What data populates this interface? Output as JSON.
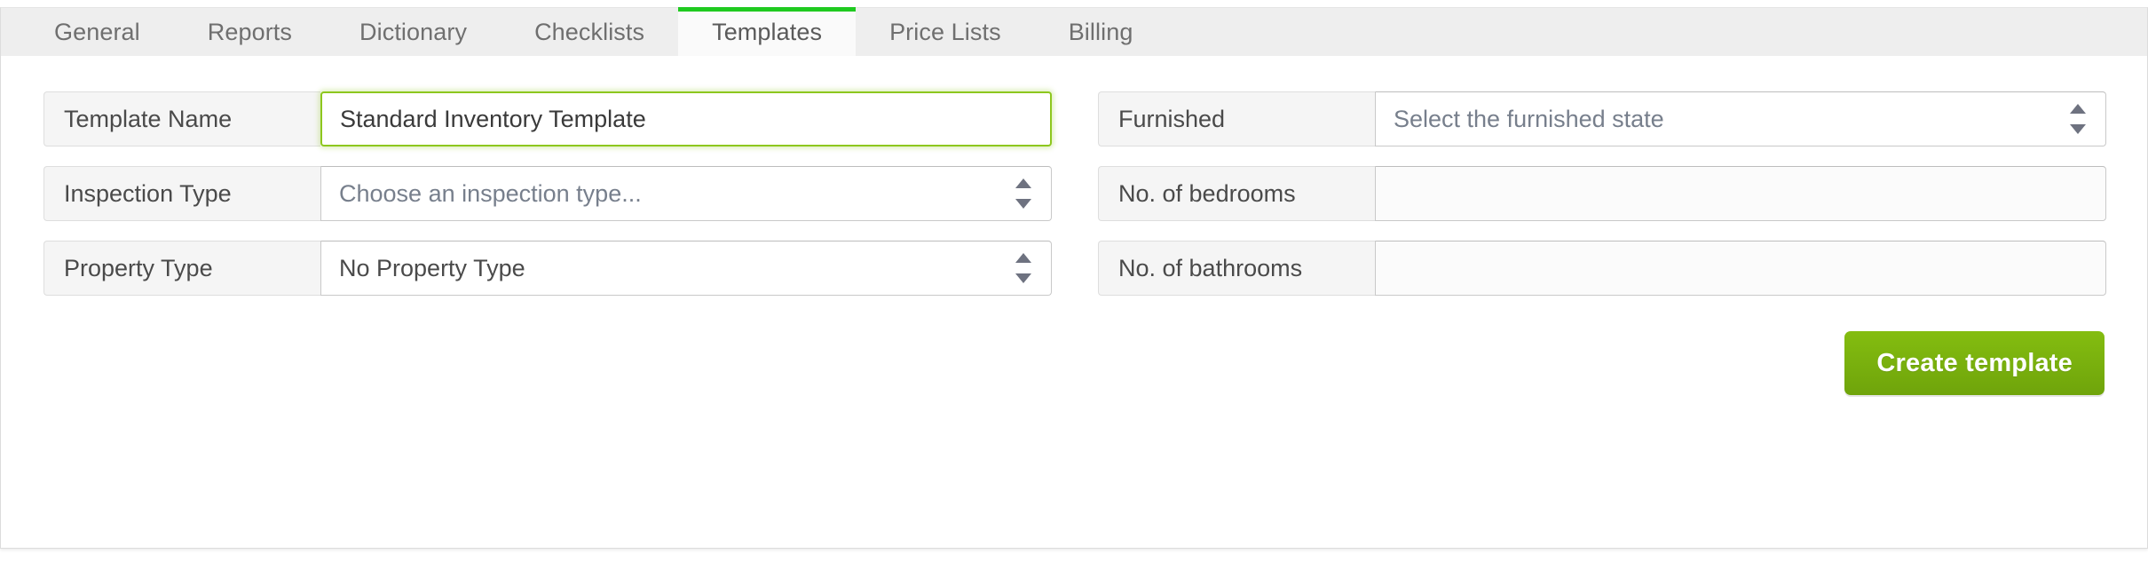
{
  "tabs": [
    {
      "label": "General",
      "active": false
    },
    {
      "label": "Reports",
      "active": false
    },
    {
      "label": "Dictionary",
      "active": false
    },
    {
      "label": "Checklists",
      "active": false
    },
    {
      "label": "Templates",
      "active": true
    },
    {
      "label": "Price Lists",
      "active": false
    },
    {
      "label": "Billing",
      "active": false
    }
  ],
  "form": {
    "left": [
      {
        "label": "Template Name",
        "value": "Standard Inventory Template",
        "placeholder": "",
        "control": "text",
        "focused": true,
        "name": "template-name"
      },
      {
        "label": "Inspection Type",
        "value": "Choose an inspection type...",
        "placeholder": "Choose an inspection type...",
        "control": "select",
        "focused": false,
        "name": "inspection-type"
      },
      {
        "label": "Property Type",
        "value": "No Property Type",
        "placeholder": "",
        "control": "select",
        "focused": false,
        "name": "property-type"
      }
    ],
    "right": [
      {
        "label": "Furnished",
        "value": "Select the furnished state",
        "placeholder": "Select the furnished state",
        "control": "select",
        "focused": false,
        "name": "furnished"
      },
      {
        "label": "No. of bedrooms",
        "value": "",
        "placeholder": "",
        "control": "text",
        "focused": false,
        "name": "no-of-bedrooms"
      },
      {
        "label": "No. of bathrooms",
        "value": "",
        "placeholder": "",
        "control": "text",
        "focused": false,
        "name": "no-of-bathrooms"
      }
    ]
  },
  "actions": {
    "submit_label": "Create template"
  },
  "colors": {
    "accent_green": "#7aae0d",
    "active_tab_indicator": "#1fca20",
    "focus_ring": "#8dc71e",
    "label_bg": "#f5f5f5",
    "tabbar_bg": "#eeeeee",
    "placeholder_text": "#777f8c"
  }
}
